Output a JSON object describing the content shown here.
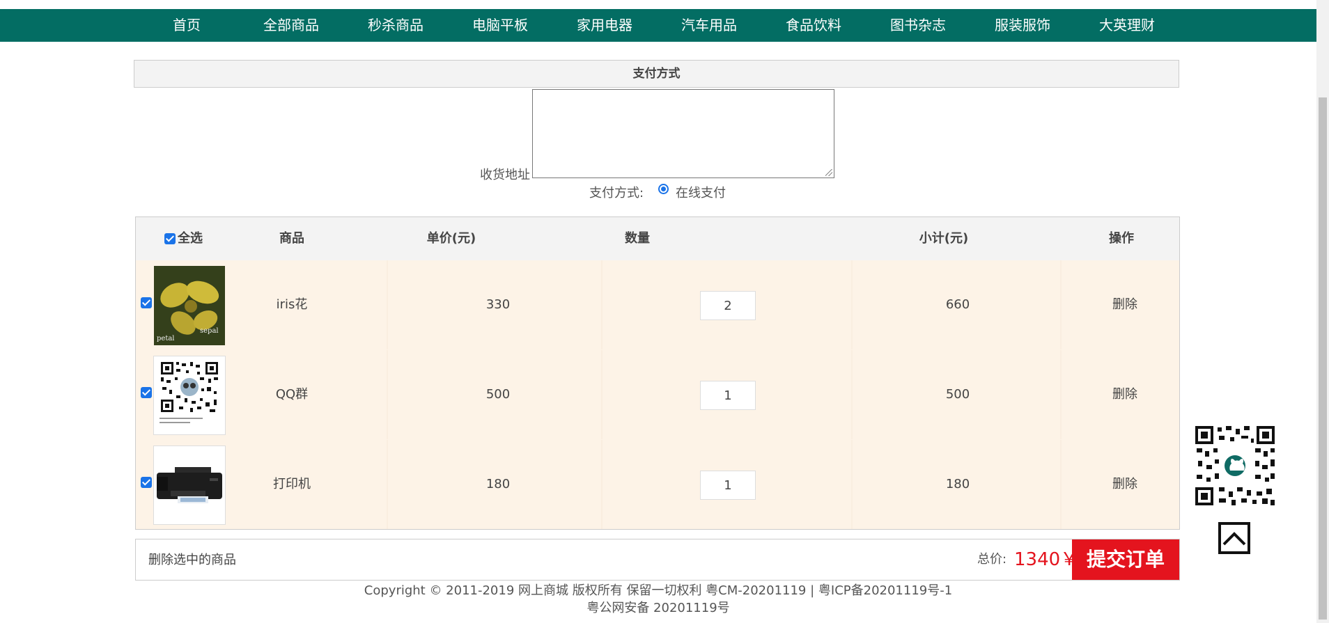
{
  "nav": [
    "首页",
    "全部商品",
    "秒杀商品",
    "电脑平板",
    "家用电器",
    "汽车用品",
    "食品饮料",
    "图书杂志",
    "服装服饰",
    "大英理财"
  ],
  "section_title": "支付方式",
  "address_label": "收货地址",
  "payment_label": "支付方式:",
  "payment_option": "在线支付",
  "table": {
    "headers": {
      "select_all": "全选",
      "product": "商品",
      "unit_price": "单价(元)",
      "quantity": "数量",
      "subtotal": "小计(元)",
      "action": "操作"
    },
    "rows": [
      {
        "name": "iris花",
        "price": "330",
        "qty": "2",
        "subtotal": "660",
        "action": "删除",
        "image": "flower-image"
      },
      {
        "name": "QQ群",
        "price": "500",
        "qty": "1",
        "subtotal": "500",
        "action": "删除",
        "image": "qr-code-image"
      },
      {
        "name": "打印机",
        "price": "180",
        "qty": "1",
        "subtotal": "180",
        "action": "删除",
        "image": "printer-image"
      }
    ]
  },
  "footer": {
    "delete_selected": "删除选中的商品",
    "total_label": "总价:",
    "total_value": "1340￥",
    "submit": "提交订单"
  },
  "image_text": {
    "flower_left": "petal",
    "flower_right": "sepal"
  },
  "copyright_line1": "Copyright © 2011-2019 网上商城 版权所有 保留一切权利 粤CM-20201119 | 粤ICP备20201119号-1",
  "copyright_line2": "粤公网安备 20201119号",
  "colors": {
    "nav_bg": "#036d63",
    "submit_bg": "#e4141e",
    "row_bg": "#fdf3e7",
    "checkbox": "#1a73e8"
  }
}
